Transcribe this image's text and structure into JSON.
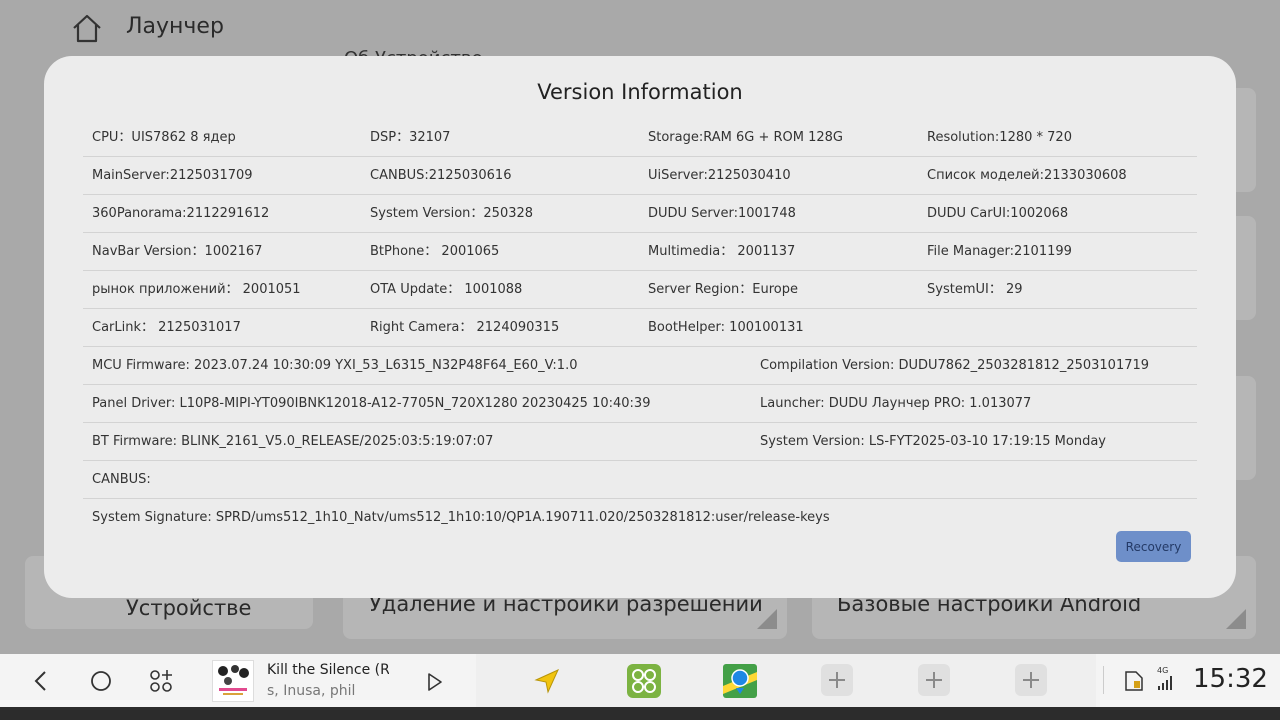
{
  "background": {
    "title": "Лаунчер",
    "subtitle": "Об Устройстве",
    "cards": [
      {
        "label": "Устройстве"
      },
      {
        "label": "Удаление и настройки разрешений"
      },
      {
        "label": "Базовые настройки Android"
      }
    ]
  },
  "dialog": {
    "title": "Version Information",
    "rows": [
      [
        "CPU：UIS7862 8 ядер",
        "DSP：32107",
        "Storage:RAM 6G + ROM 128G",
        "Resolution:1280 * 720"
      ],
      [
        "MainServer:2125031709",
        "CANBUS:2125030616",
        "UiServer:2125030410",
        "Список моделей:2133030608"
      ],
      [
        "360Panorama:2112291612",
        "System Version：250328",
        "DUDU Server:1001748",
        "DUDU CarUI:1002068"
      ],
      [
        "NavBar Version：1002167",
        "BtPhone：  2001065",
        "Multimedia：  2001137",
        "File Manager:2101199"
      ],
      [
        "рынок приложений：  2001051",
        "OTA Update：  1001088",
        "Server Region：Europe",
        "SystemUI：  29"
      ],
      [
        "CarLink：  2125031017",
        "Right Camera：  2124090315",
        "BootHelper: 100100131",
        ""
      ]
    ],
    "wide_rows": [
      [
        "MCU Firmware:  2023.07.24 10:30:09 YXI_53_L6315_N32P48F64_E60_V:1.0",
        "Compilation Version:  DUDU7862_2503281812_2503101719"
      ],
      [
        "Panel Driver:  L10P8-MIPI-YT090IBNK12018-A12-7705N_720X1280 20230425 10:40:39",
        "Launcher:  DUDU Лаунчер PRO: 1.013077"
      ],
      [
        "BT Firmware:  BLINK_2161_V5.0_RELEASE/2025:03:5:19:07:07",
        "System Version:  LS-FYT2025-03-10 17:19:15 Monday"
      ]
    ],
    "canbus_label": "CANBUS:",
    "signature": "System Signature:  SPRD/ums512_1h10_Natv/ums512_1h10:10/QP1A.190711.020/2503281812:user/release-keys",
    "recovery_label": "Recovery"
  },
  "navbar": {
    "track_title": "Kill the Silence (R",
    "track_artist": "s, Inusa, phil",
    "clock": "15:32",
    "signal_label": "4G"
  },
  "colors": {
    "dialog_bg": "#ececec",
    "recovery_bg": "#6e8fc9",
    "overlay_bg": "#a9a9a9"
  }
}
